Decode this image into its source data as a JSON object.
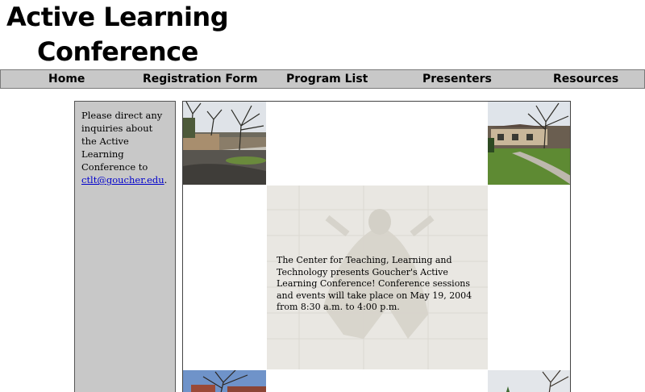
{
  "header": {
    "title_line1": "Active Learning",
    "title_line2": "Conference"
  },
  "nav": {
    "items": [
      {
        "label": "Home"
      },
      {
        "label": "Registration Form"
      },
      {
        "label": "Program List"
      },
      {
        "label": "Presenters"
      },
      {
        "label": "Resources"
      }
    ]
  },
  "sidebar": {
    "text": "Please direct any inquiries about the Active Learning Conference to",
    "email": "ctlt@goucher.edu",
    "suffix": "."
  },
  "main": {
    "intro": "The Center for Teaching, Learning and Technology presents Goucher's Active Learning Conference! Conference sessions and events will take place on May 19, 2004 from 8:30 a.m. to 4:00 p.m."
  },
  "colors": {
    "nav_background": "#c8c8c8",
    "sidebar_background": "#c8c8c8",
    "link": "#0000cc"
  }
}
